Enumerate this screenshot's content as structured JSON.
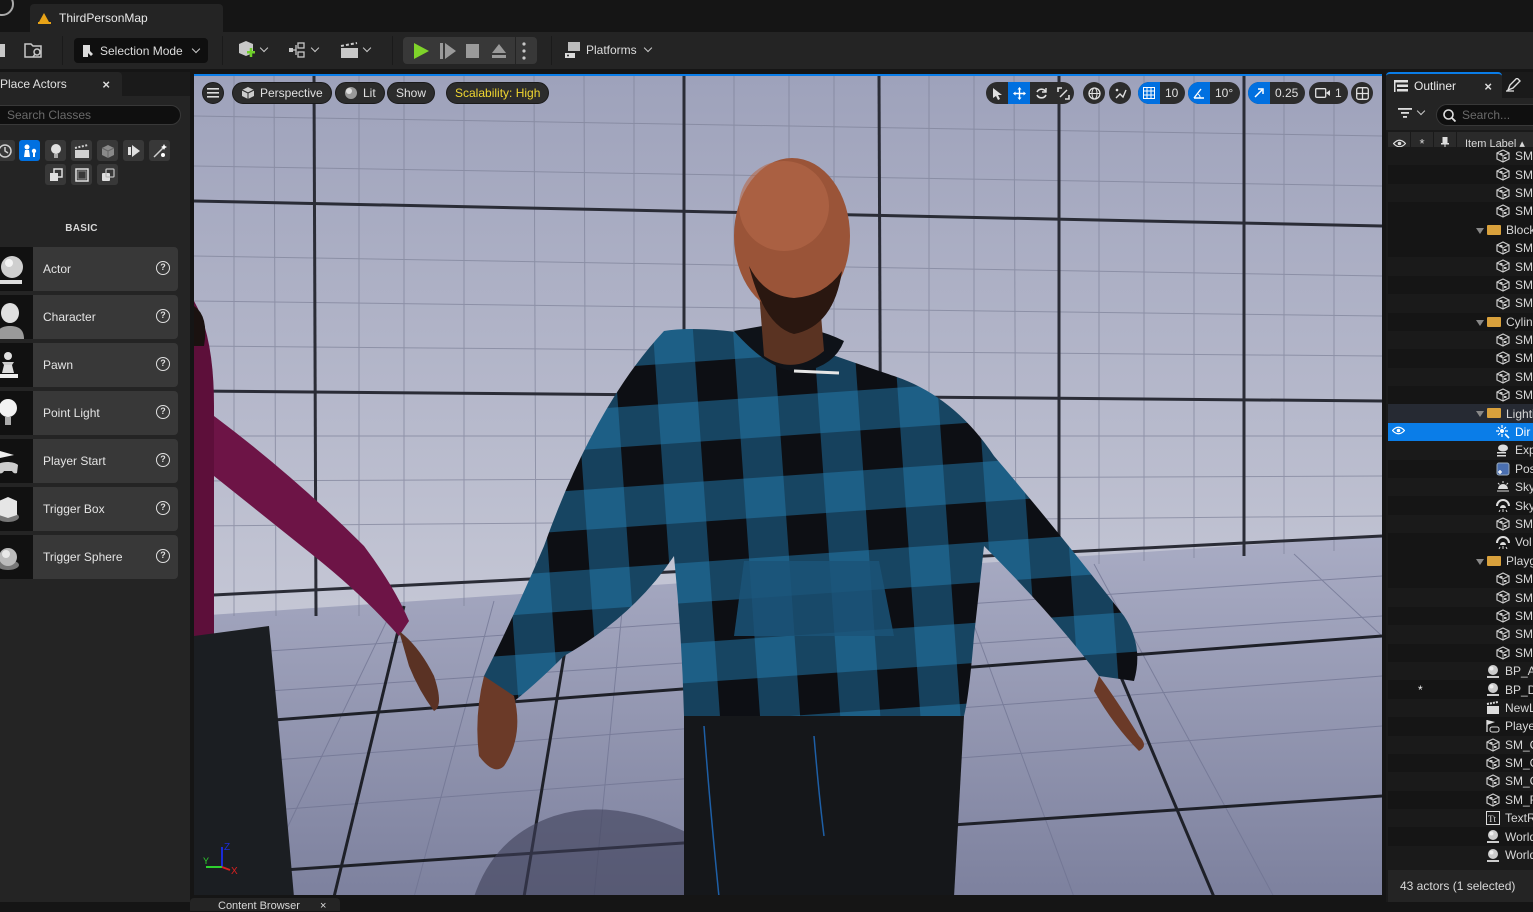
{
  "window": {
    "document_tab": "ThirdPersonMap"
  },
  "toolbar": {
    "selection_mode": "Selection Mode",
    "platforms": "Platforms",
    "icons": [
      "save-icon",
      "content-browser-icon",
      "add-actor-icon",
      "blueprint-icon",
      "cinematics-icon",
      "play-icon",
      "advance-frame-icon",
      "stop-icon",
      "eject-icon",
      "more-options-icon",
      "platforms-icon"
    ]
  },
  "place_actors": {
    "tab_label": "Place Actors",
    "close": "×",
    "search_placeholder": "Search Classes",
    "category_icons": [
      "recent-icon",
      "basic-icon",
      "lights-icon",
      "cinematic-icon",
      "visual-effects-icon",
      "volumes-icon",
      "all-classes-icon",
      "geometry-icon",
      "shapes-icon",
      "misc-icon"
    ],
    "active_category": "basic",
    "section_label": "BASIC",
    "items": [
      {
        "label": "Actor",
        "icon": "actor-icon"
      },
      {
        "label": "Character",
        "icon": "character-icon"
      },
      {
        "label": "Pawn",
        "icon": "pawn-icon"
      },
      {
        "label": "Point Light",
        "icon": "point-light-icon"
      },
      {
        "label": "Player Start",
        "icon": "player-start-icon"
      },
      {
        "label": "Trigger Box",
        "icon": "trigger-box-icon"
      },
      {
        "label": "Trigger Sphere",
        "icon": "trigger-sphere-icon"
      }
    ]
  },
  "viewport": {
    "menu": "☰",
    "view_mode": "Perspective",
    "lighting": "Lit",
    "show": "Show",
    "scalability": "Scalability: High",
    "grid_snap": "10",
    "rotation_snap": "10°",
    "scale_snap": "0.25",
    "camera_speed": "1",
    "axis": {
      "x": "X",
      "y": "Y",
      "z": "Z"
    },
    "colors": {
      "accent": "#0070e0",
      "scalability": "#f0d630"
    }
  },
  "outliner": {
    "tab_label": "Outliner",
    "close": "×",
    "search_placeholder": "Search...",
    "column_label": "Item Label ▴",
    "rows": [
      {
        "type": "mesh",
        "name": "SM",
        "indent": 2
      },
      {
        "type": "mesh",
        "name": "SM",
        "indent": 2
      },
      {
        "type": "mesh",
        "name": "SM",
        "indent": 2
      },
      {
        "type": "mesh",
        "name": "SM",
        "indent": 2
      },
      {
        "type": "folder",
        "name": "Block",
        "indent": 1
      },
      {
        "type": "mesh",
        "name": "SM",
        "indent": 2
      },
      {
        "type": "mesh",
        "name": "SM",
        "indent": 2
      },
      {
        "type": "mesh",
        "name": "SM",
        "indent": 2
      },
      {
        "type": "mesh",
        "name": "SM",
        "indent": 2
      },
      {
        "type": "folder",
        "name": "Cylinder",
        "indent": 1
      },
      {
        "type": "mesh",
        "name": "SM",
        "indent": 2
      },
      {
        "type": "mesh",
        "name": "SM",
        "indent": 2
      },
      {
        "type": "mesh",
        "name": "SM",
        "indent": 2
      },
      {
        "type": "mesh",
        "name": "SM",
        "indent": 2
      },
      {
        "type": "folder",
        "name": "Lighting",
        "indent": 1,
        "hilite": true
      },
      {
        "type": "light",
        "name": "Dir",
        "indent": 2,
        "selected": true
      },
      {
        "type": "fog",
        "name": "Exp",
        "indent": 2
      },
      {
        "type": "post",
        "name": "Pos",
        "indent": 2
      },
      {
        "type": "sky",
        "name": "Sky",
        "indent": 2
      },
      {
        "type": "skylight",
        "name": "Sky",
        "indent": 2
      },
      {
        "type": "mesh",
        "name": "SM",
        "indent": 2
      },
      {
        "type": "skylight",
        "name": "Vol",
        "indent": 2
      },
      {
        "type": "folder",
        "name": "Playground",
        "indent": 1
      },
      {
        "type": "mesh",
        "name": "SM",
        "indent": 2
      },
      {
        "type": "mesh",
        "name": "SM",
        "indent": 2
      },
      {
        "type": "mesh",
        "name": "SM",
        "indent": 2
      },
      {
        "type": "mesh",
        "name": "SM",
        "indent": 2
      },
      {
        "type": "mesh",
        "name": "SM",
        "indent": 2
      },
      {
        "type": "actor",
        "name": "BP_A",
        "indent": 0
      },
      {
        "type": "actor",
        "name": "BP_D",
        "indent": 0,
        "starred": true
      },
      {
        "type": "cine",
        "name": "NewL",
        "indent": 0
      },
      {
        "type": "playerstart",
        "name": "Playe",
        "indent": 0
      },
      {
        "type": "mesh",
        "name": "SM_C",
        "indent": 0
      },
      {
        "type": "mesh",
        "name": "SM_C",
        "indent": 0
      },
      {
        "type": "mesh",
        "name": "SM_C",
        "indent": 0
      },
      {
        "type": "mesh",
        "name": "SM_F",
        "indent": 0
      },
      {
        "type": "text",
        "name": "TextR",
        "indent": 0
      },
      {
        "type": "actor",
        "name": "World",
        "indent": 0
      },
      {
        "type": "actor",
        "name": "World",
        "indent": 0
      }
    ],
    "status": "43 actors (1 selected)"
  },
  "bottom": {
    "content_browser_tab": "Content Browser",
    "close": "×"
  }
}
